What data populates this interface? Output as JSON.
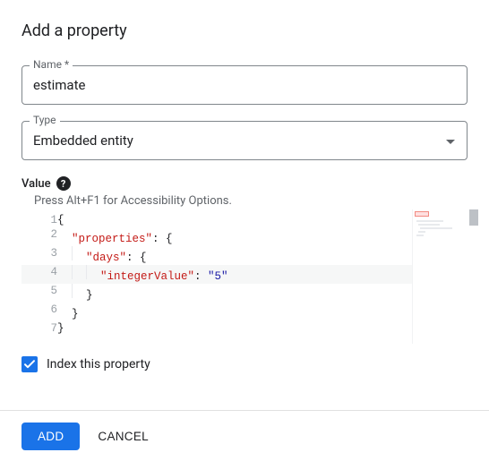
{
  "dialog": {
    "title": "Add a property",
    "name_field": {
      "label": "Name *",
      "value": "estimate"
    },
    "type_field": {
      "label": "Type",
      "value": "Embedded entity"
    },
    "value_section": {
      "label": "Value",
      "help_icon": "?",
      "a11y_hint": "Press Alt+F1 for Accessibility Options."
    },
    "index_checkbox": {
      "label": "Index this property",
      "checked": true
    },
    "footer": {
      "add": "ADD",
      "cancel": "CANCEL"
    }
  },
  "code": {
    "lines": [
      {
        "n": "1",
        "indent": 0,
        "tokens": [
          {
            "t": "{",
            "c": ""
          }
        ]
      },
      {
        "n": "2",
        "indent": 1,
        "tokens": [
          {
            "t": "\"properties\"",
            "c": "tok-key"
          },
          {
            "t": ": {",
            "c": ""
          }
        ]
      },
      {
        "n": "3",
        "indent": 2,
        "tokens": [
          {
            "t": "\"days\"",
            "c": "tok-key"
          },
          {
            "t": ": {",
            "c": ""
          }
        ]
      },
      {
        "n": "4",
        "indent": 3,
        "active": true,
        "tokens": [
          {
            "t": "\"integerValue\"",
            "c": "tok-key"
          },
          {
            "t": ": ",
            "c": ""
          },
          {
            "t": "\"5\"",
            "c": "tok-str"
          }
        ]
      },
      {
        "n": "5",
        "indent": 2,
        "tokens": [
          {
            "t": "}",
            "c": ""
          }
        ]
      },
      {
        "n": "6",
        "indent": 1,
        "tokens": [
          {
            "t": "}",
            "c": ""
          }
        ]
      },
      {
        "n": "7",
        "indent": 0,
        "tokens": [
          {
            "t": "}",
            "c": ""
          }
        ]
      }
    ]
  }
}
